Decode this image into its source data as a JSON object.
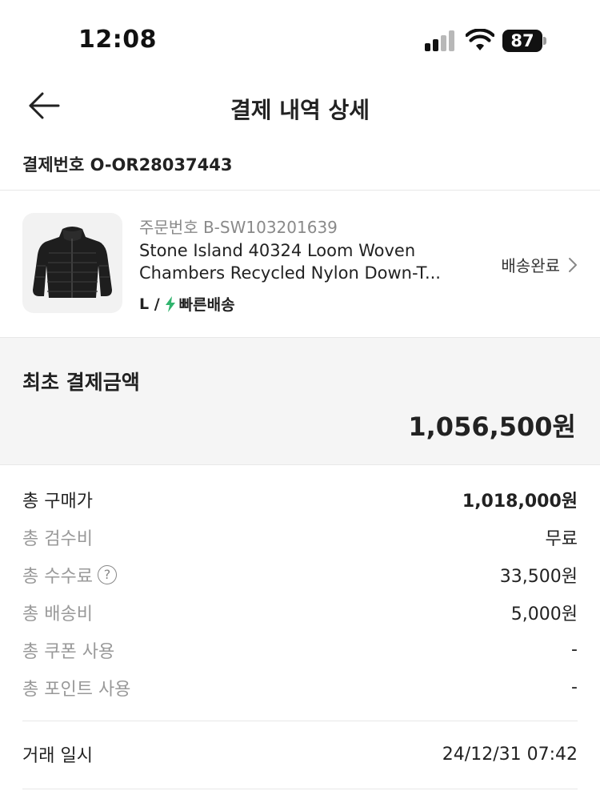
{
  "status_bar": {
    "time": "12:08",
    "battery": "87"
  },
  "header": {
    "title": "결제 내역 상세",
    "back_icon": "arrow-left-icon"
  },
  "payment": {
    "number_label": "결제번호 O-OR28037443"
  },
  "order": {
    "order_number": "주문번호 B-SW103201639",
    "product_line1": "Stone Island 40324 Loom Woven",
    "product_line2": "Chambers Recycled Nylon Down-T...",
    "size": "L /",
    "fast_delivery": "빠른배송",
    "status": "배송완료",
    "accent_color": "#31b46e"
  },
  "summary": {
    "label": "최초 결제금액",
    "amount": "1,056,500원"
  },
  "details": [
    {
      "label": "총 구매가",
      "value": "1,018,000원"
    },
    {
      "label": "총 검수비",
      "value": "무료"
    },
    {
      "label": "총 수수료",
      "value": "33,500원",
      "help": "?"
    },
    {
      "label": "총 배송비",
      "value": "5,000원"
    },
    {
      "label": "총 쿠폰 사용",
      "value": "-"
    },
    {
      "label": "총 포인트 사용",
      "value": "-"
    }
  ],
  "transaction": {
    "label": "거래 일시",
    "value": "24/12/31 07:42"
  }
}
